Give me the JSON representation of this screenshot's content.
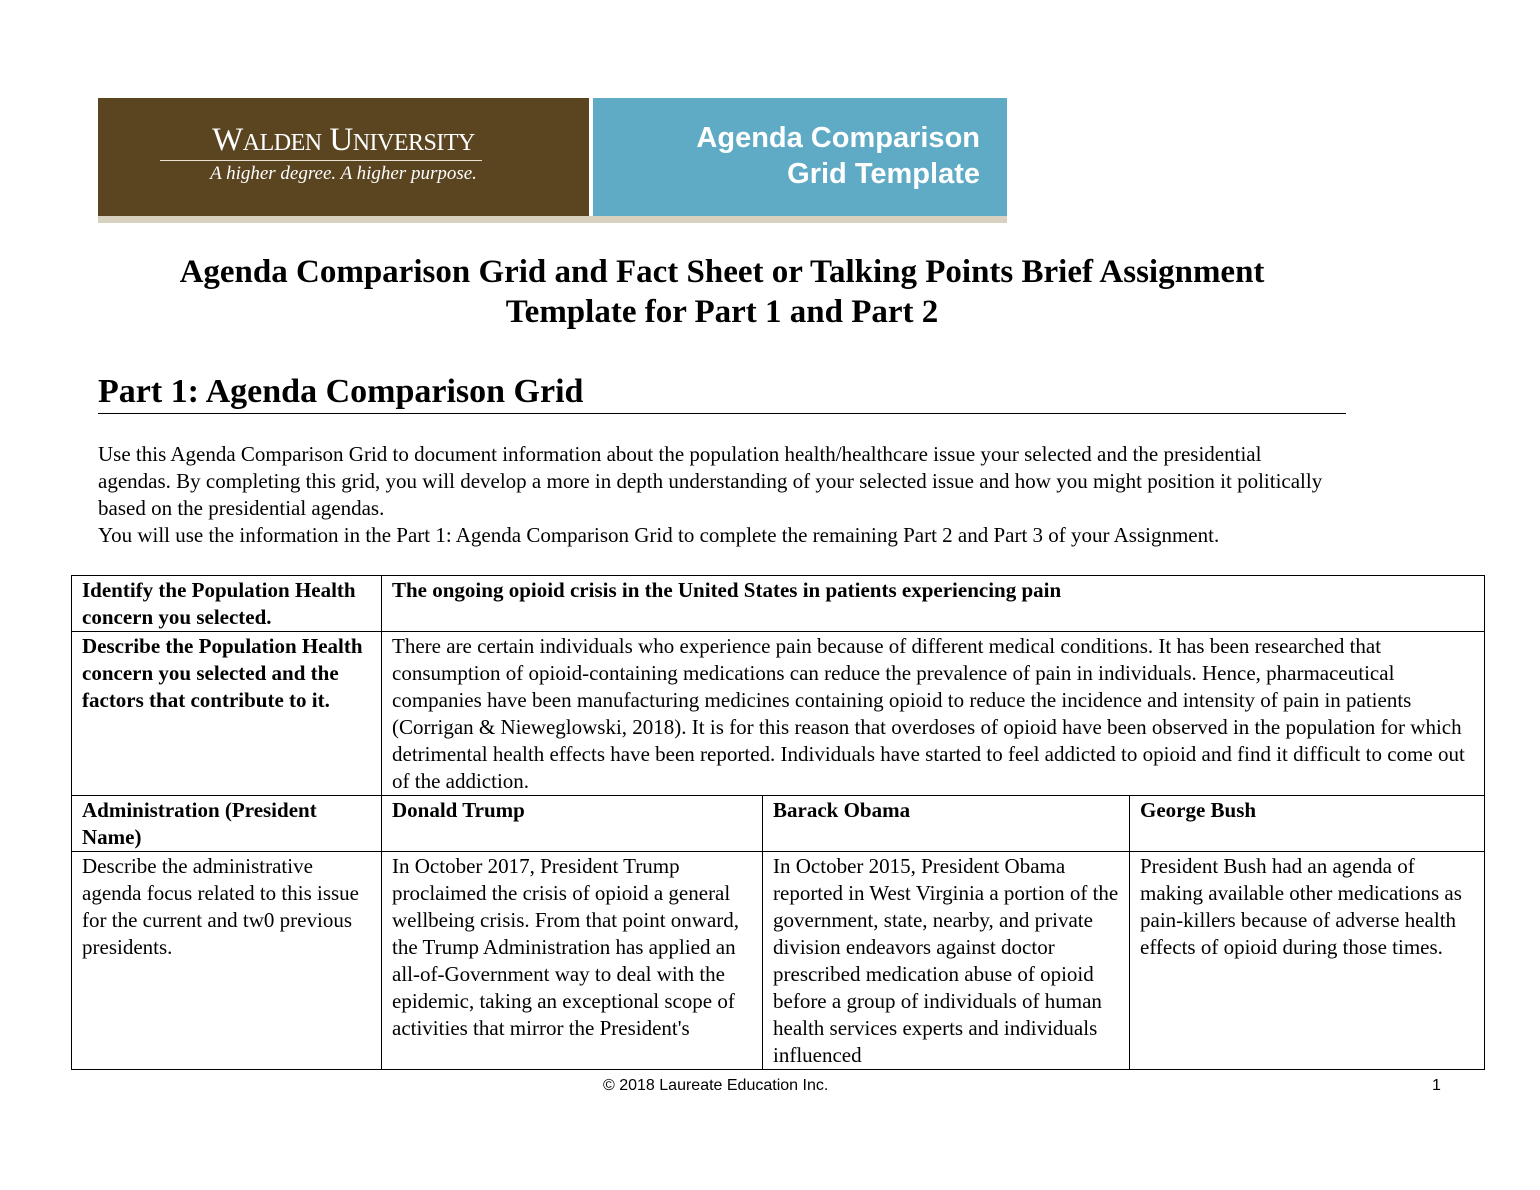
{
  "banner": {
    "university_name": "Walden University",
    "tagline": "A higher degree. A higher purpose.",
    "title_line1": "Agenda Comparison",
    "title_line2": "Grid Template",
    "colors": {
      "brown": "#5a4520",
      "blue": "#5faac4",
      "strip": "#d9d1c0"
    }
  },
  "document": {
    "title_line1": "Agenda Comparison Grid and Fact Sheet or Talking Points Brief Assignment",
    "title_line2": "Template for Part 1 and Part 2",
    "part_heading": "Part 1: Agenda Comparison Grid",
    "intro_paragraph1": "Use this Agenda Comparison Grid to document information about the population health/healthcare issue your selected and the presidential agendas. By completing this grid, you will develop a more in depth understanding of your selected issue and how you might position it politically based on the presidential agendas.",
    "intro_paragraph2": "You will use the information in the Part 1: Agenda Comparison Grid to complete the remaining Part 2 and Part 3 of your Assignment."
  },
  "grid": {
    "row1": {
      "label": "Identify the Population Health concern you selected.",
      "value": "The ongoing opioid crisis in the United States in patients experiencing pain"
    },
    "row2": {
      "label": "Describe the Population Health concern you selected and the factors that contribute to it.",
      "value": "There are certain individuals who experience pain because of different medical conditions. It has been researched that consumption of opioid-containing medications can reduce the prevalence of pain in individuals. Hence, pharmaceutical companies have been manufacturing medicines containing opioid to reduce the incidence and intensity of pain in patients (Corrigan & Nieweglowski, 2018). It is for this reason that overdoses of opioid have been observed in the population for which detrimental health effects have been reported. Individuals have started to feel addicted to opioid and find it difficult to come out of the addiction."
    },
    "row3": {
      "label": "Administration (President Name)",
      "presidents": [
        "Donald Trump",
        "Barack Obama",
        "George Bush"
      ]
    },
    "row4": {
      "label": "Describe the administrative agenda focus related to this issue for the current and tw0 previous presidents.",
      "agendas": [
        "In October 2017, President Trump proclaimed the crisis of opioid a general wellbeing crisis. From that point onward, the Trump Administration has applied an all-of-Government way to deal with the epidemic, taking an exceptional scope of activities that mirror the President's",
        "In October 2015, President Obama reported in West Virginia a portion of the government, state, nearby, and private division endeavors against doctor prescribed medication abuse of opioid before a group of individuals of human health services experts and individuals influenced",
        "President Bush had an agenda of making available other medications as pain-killers because of adverse health effects of opioid during those times."
      ]
    }
  },
  "footer": {
    "copyright": "© 2018 Laureate Education Inc.",
    "page_number": "1"
  }
}
